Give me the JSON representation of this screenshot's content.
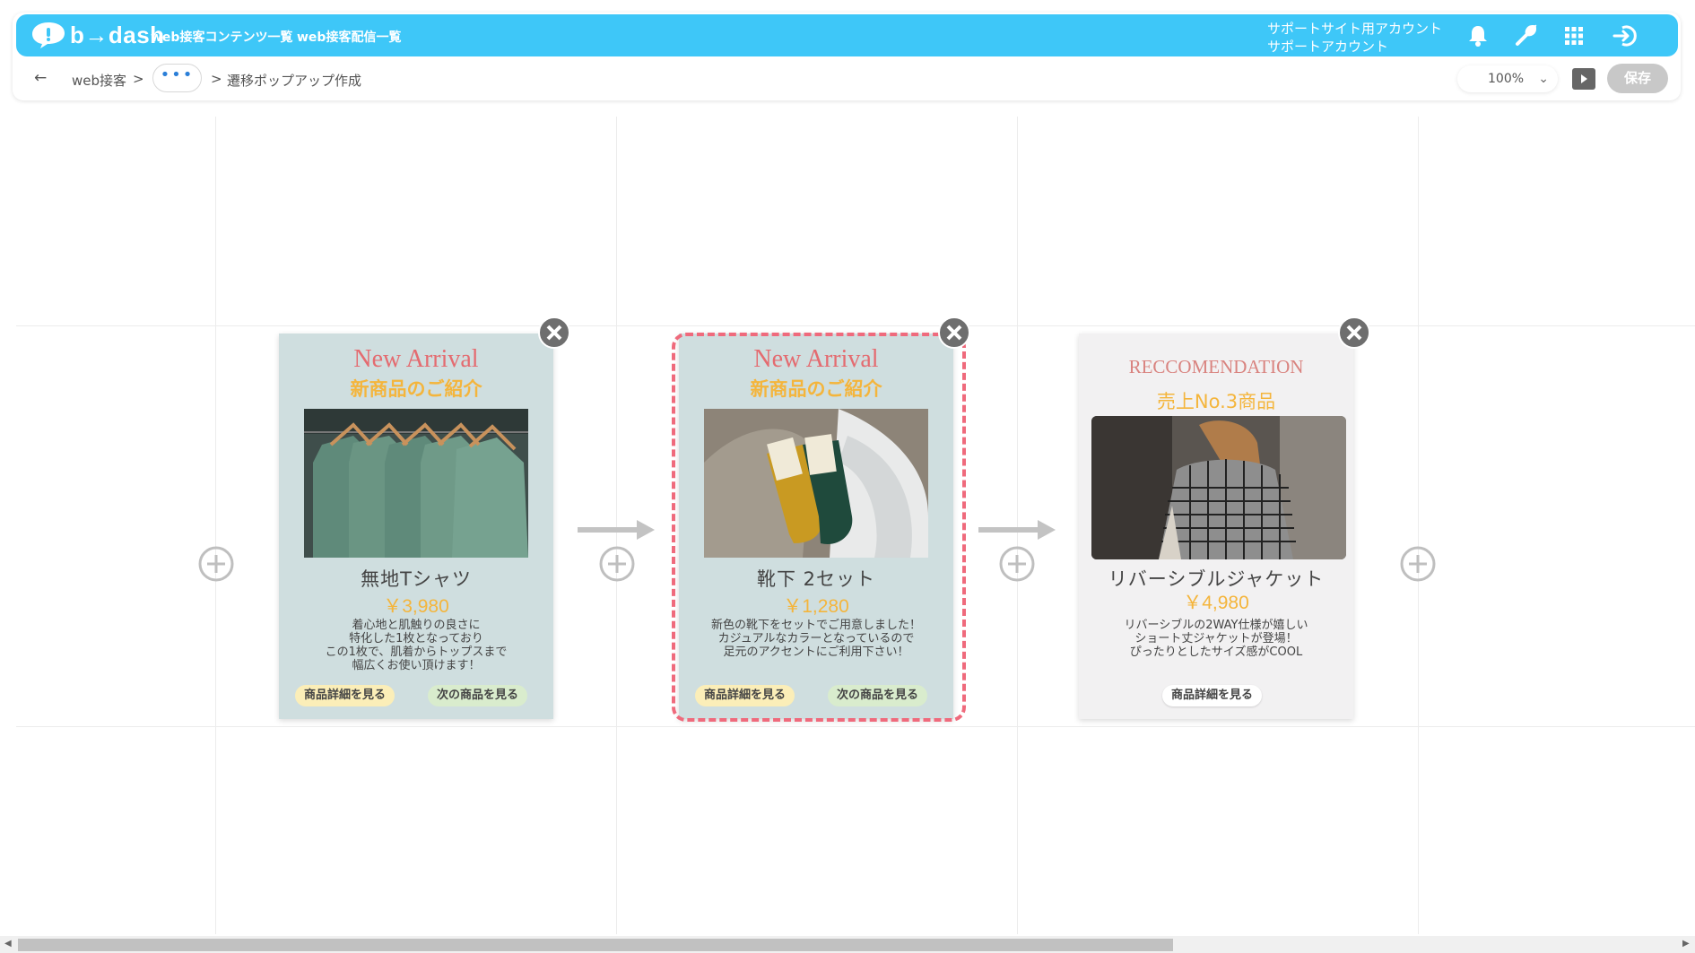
{
  "brand": {
    "name": "b→dash",
    "accent": "#3ec7f8"
  },
  "nav": {
    "links": [
      "web接客コンテンツ一覧",
      "web接客配信一覧"
    ],
    "account_line1": "サポートサイト用アカウント",
    "account_line2": "サポートアカウント",
    "icons": [
      "bell-icon",
      "wrench-icon",
      "grid-icon",
      "logout-icon"
    ]
  },
  "breadcrumb": {
    "back": "←",
    "item1": "web接客",
    "sep": ">",
    "more": "•••",
    "current": "遷移ポップアップ作成"
  },
  "toolbar": {
    "zoom": "100%",
    "save_label": "保存"
  },
  "cards": [
    {
      "title": "New Arrival",
      "subtitle": "新商品のご紹介",
      "product": "無地Tシャツ",
      "price": "￥3,980",
      "desc": "着心地と肌触りの良さに\n特化した1枚となっており\nこの1枚で、肌着からトップスまで\n幅広くお使い頂けます！",
      "btn1": "商品詳細を見る",
      "btn2": "次の商品を見る",
      "photo": "green-tshirts-on-hangers"
    },
    {
      "title": "New Arrival",
      "subtitle": "新商品のご紹介",
      "product": "靴下 2セット",
      "price": "￥1,280",
      "desc": "新色の靴下をセットでご用意しました！\nカジュアルなカラーとなっているので\n足元のアクセントにご利用下さい！",
      "btn1": "商品詳細を見る",
      "btn2": "次の商品を見る",
      "photo": "socks-mustard-and-green",
      "selected": true
    },
    {
      "title": "RECCOMENDATION",
      "subtitle": "売上No.3商品",
      "product": "リバーシブルジャケット",
      "price": "￥4,980",
      "desc": "リバーシブルの2WAY仕様が嬉しい\nショート丈ジャケットが登場！\nぴったりとしたサイズ感がCOOL",
      "btn1": "商品詳細を見る",
      "photo": "checked-jacket-back-view"
    }
  ]
}
